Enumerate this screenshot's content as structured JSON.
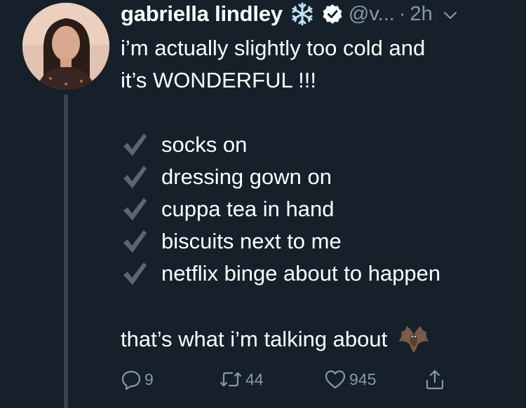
{
  "author": {
    "name": "gabriella lindley",
    "handle": "@v...",
    "separator": "·",
    "time": "2h"
  },
  "tweet": {
    "line1": "i’m actually slightly too cold and",
    "line2": "it’s WONDERFUL !!!",
    "checklist": [
      "socks on",
      "dressing gown on",
      "cuppa tea in hand",
      "biscuits next to me",
      "netflix binge about to happen"
    ],
    "closing": "that’s what i’m talking about"
  },
  "actions": {
    "replies": "9",
    "retweets": "44",
    "likes": "945"
  },
  "colors": {
    "background": "#15202b",
    "secondary_text": "#8899a6",
    "thread_line": "#38444d",
    "check": "#5b6670"
  },
  "icons": [
    "snowflake-icon",
    "verified-badge-icon",
    "chevron-down-icon",
    "check-icon",
    "bat-icon",
    "reply-icon",
    "retweet-icon",
    "like-icon",
    "share-icon"
  ]
}
